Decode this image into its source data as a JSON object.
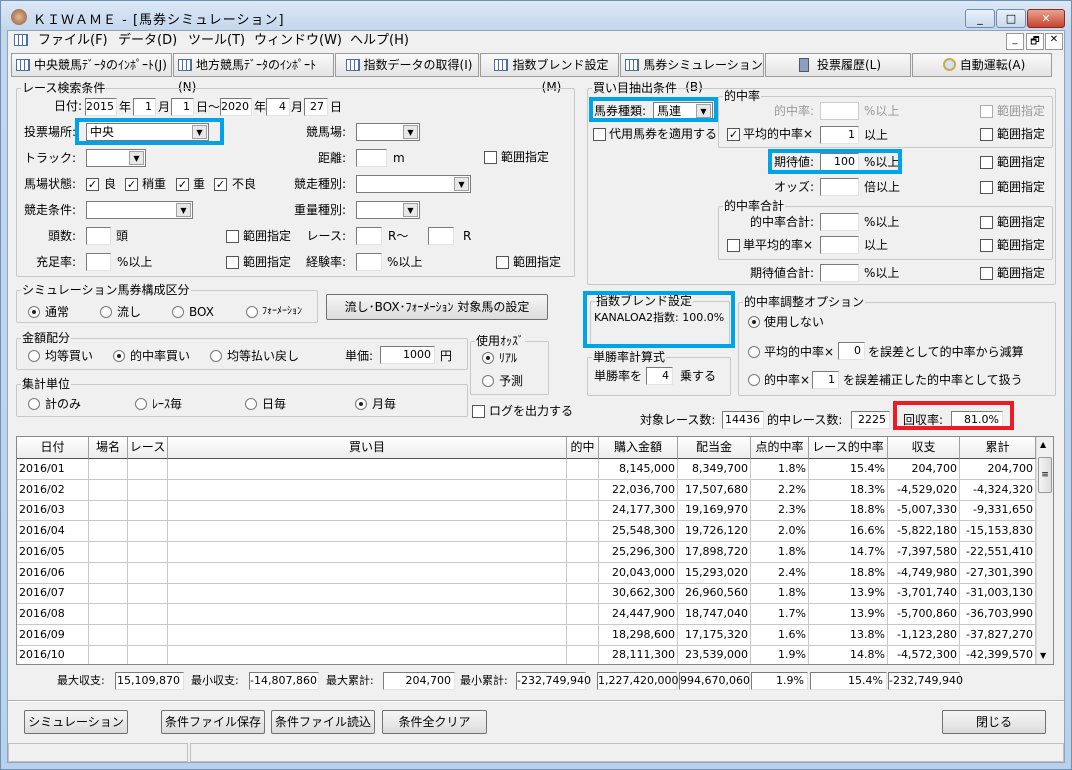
{
  "window": {
    "title": "ＫＩＷＡＭＥ - [馬券シミュレーション]",
    "minimize": "_",
    "maximize": "□",
    "close": "✕",
    "mdi_minimize": "_",
    "mdi_restore": "🗗",
    "mdi_close": "✕"
  },
  "menu": [
    "ファイル(F)",
    "データ(D)",
    "ツール(T)",
    "ウィンドウ(W)",
    "ヘルプ(H)"
  ],
  "toolbar": [
    {
      "label": "中央競馬ﾃﾞｰﾀのｲﾝﾎﾟｰﾄ(J)",
      "icon": "grid-icon"
    },
    {
      "label": "地方競馬ﾃﾞｰﾀのｲﾝﾎﾟｰﾄ(N)",
      "icon": "grid-icon"
    },
    {
      "label": "指数データの取得(I)",
      "icon": "grid-icon"
    },
    {
      "label": "指数ブレンド設定(M)",
      "icon": "grid-icon"
    },
    {
      "label": "馬券シミュレーション(B)",
      "icon": "grid-icon"
    },
    {
      "label": "投票履歴(L)",
      "icon": "calculator-icon"
    },
    {
      "label": "自動運転(A)",
      "icon": "clock-icon"
    }
  ],
  "race_search": {
    "title": "レース検索条件",
    "date_label": "日付:",
    "from_year": "2015",
    "year": "年",
    "from_month": "1",
    "month": "月",
    "from_day": "1",
    "day_tilde": "日～",
    "to_year": "2020",
    "to_month": "4",
    "to_day": "27",
    "day": "日",
    "venue_type_label": "投票場所:",
    "venue_type": "中央",
    "course_label": "競馬場:",
    "course": "",
    "track_label": "トラック:",
    "track": "",
    "distance_label": "距離:",
    "distance": "",
    "distance_unit": "m",
    "range": "範囲指定",
    "going_label": "馬場状態:",
    "going": [
      {
        "label": "良",
        "checked": true
      },
      {
        "label": "稍重",
        "checked": true
      },
      {
        "label": "重",
        "checked": true
      },
      {
        "label": "不良",
        "checked": true
      }
    ],
    "race_type_label": "競走種別:",
    "race_type": "",
    "race_cond_label": "競走条件:",
    "race_cond": "",
    "weight_type_label": "重量種別:",
    "weight_type": "",
    "heads_label": "頭数:",
    "heads": "",
    "heads_unit": "頭",
    "race_label": "レース:",
    "race_from": "",
    "race_mid": "R～",
    "race_to": "",
    "race_unit": "R",
    "fill_label": "充足率:",
    "fill": "",
    "pct_over": "%以上",
    "exp_label": "経験率:",
    "exp": ""
  },
  "composition": {
    "title": "シミュレーション馬券構成区分",
    "options": [
      "通常",
      "流し",
      "BOX",
      "ﾌｫｰﾒｰｼｮﾝ"
    ],
    "selected": "通常",
    "target_button": "流し･BOX･ﾌｫｰﾒｰｼｮﾝ  対象馬の設定"
  },
  "allocation": {
    "title": "金額配分",
    "options": [
      "均等買い",
      "的中率買い",
      "均等払い戻し"
    ],
    "selected": "的中率買い",
    "unit_label": "単価:",
    "unit_price": "1000",
    "yen": "円"
  },
  "odds": {
    "title": "使用ｵｯｽﾞ",
    "options": [
      "ﾘｱﾙ",
      "予測"
    ],
    "selected": "ﾘｱﾙ"
  },
  "aggregation": {
    "title": "集計単位",
    "options": [
      "計のみ",
      "ﾚｰｽ毎",
      "日毎",
      "月毎"
    ],
    "selected": "月毎"
  },
  "log_output": {
    "label": "ログを出力する",
    "checked": false
  },
  "bet_extract": {
    "title": "買い目抽出条件",
    "bet_type_label": "馬券種類:",
    "bet_type": "馬連",
    "substitute": {
      "label": "代用馬券を適用する",
      "checked": false
    },
    "hit_group": "的中率",
    "hit_label": "的中率:",
    "hit": "",
    "pct_over": "%以上",
    "avg_hit": {
      "label": "平均的中率×",
      "checked": true
    },
    "avg_hit_value": "1",
    "over": "以上",
    "ev_label": "期待値:",
    "ev": "100",
    "odds_label": "オッズ:",
    "odds": "",
    "odds_unit": "倍以上",
    "hit_sum_group": "的中率合計",
    "hit_sum_label": "的中率合計:",
    "hit_sum": "",
    "single_avg": {
      "label": "単平均的率×",
      "checked": false
    },
    "single_avg_value": "",
    "ev_sum_label": "期待値合計:",
    "ev_sum": "",
    "range": "範囲指定"
  },
  "blend": {
    "title": "指数ブレンド設定",
    "text": "KANALOA2指数: 100.0%"
  },
  "win_rate": {
    "title": "単勝率計算式",
    "prefix": "単勝率を",
    "value": "4",
    "suffix": "乗する"
  },
  "hit_adjust": {
    "title": "的中率調整オプション",
    "opt1": "使用しない",
    "opt2_prefix": "平均的中率×",
    "opt2_value": "0",
    "opt2_suffix": "を誤差として的中率から減算",
    "opt3_prefix": "的中率×",
    "opt3_value": "1",
    "opt3_suffix": "を誤差補正した的中率として扱う",
    "selected": 1
  },
  "counts": {
    "target_label": "対象レース数:",
    "target": "14436",
    "hit_label": "的中レース数:",
    "hit": "2225",
    "recovery_label": "回収率:",
    "recovery": "81.0%"
  },
  "table": {
    "columns": [
      "日付",
      "場名",
      "レース",
      "買い目",
      "的中",
      "購入金額",
      "配当金",
      "点的中率",
      "レース的中率",
      "収支",
      "累計"
    ],
    "rows": [
      [
        "2016/01",
        "",
        "",
        "",
        "",
        "8,145,000",
        "8,349,700",
        "1.8%",
        "15.4%",
        "204,700",
        "204,700"
      ],
      [
        "2016/02",
        "",
        "",
        "",
        "",
        "22,036,700",
        "17,507,680",
        "2.2%",
        "18.3%",
        "-4,529,020",
        "-4,324,320"
      ],
      [
        "2016/03",
        "",
        "",
        "",
        "",
        "24,177,300",
        "19,169,970",
        "2.3%",
        "18.8%",
        "-5,007,330",
        "-9,331,650"
      ],
      [
        "2016/04",
        "",
        "",
        "",
        "",
        "25,548,300",
        "19,726,120",
        "2.0%",
        "16.6%",
        "-5,822,180",
        "-15,153,830"
      ],
      [
        "2016/05",
        "",
        "",
        "",
        "",
        "25,296,300",
        "17,898,720",
        "1.8%",
        "14.7%",
        "-7,397,580",
        "-22,551,410"
      ],
      [
        "2016/06",
        "",
        "",
        "",
        "",
        "20,043,000",
        "15,293,020",
        "2.4%",
        "18.8%",
        "-4,749,980",
        "-27,301,390"
      ],
      [
        "2016/07",
        "",
        "",
        "",
        "",
        "30,662,300",
        "26,960,560",
        "1.8%",
        "13.9%",
        "-3,701,740",
        "-31,003,130"
      ],
      [
        "2016/08",
        "",
        "",
        "",
        "",
        "24,447,900",
        "18,747,040",
        "1.7%",
        "13.9%",
        "-5,700,860",
        "-36,703,990"
      ],
      [
        "2016/09",
        "",
        "",
        "",
        "",
        "18,298,600",
        "17,175,320",
        "1.6%",
        "13.8%",
        "-1,123,280",
        "-37,827,270"
      ],
      [
        "2016/10",
        "",
        "",
        "",
        "",
        "28,111,300",
        "23,539,000",
        "1.9%",
        "14.8%",
        "-4,572,300",
        "-42,399,570"
      ]
    ]
  },
  "summary": {
    "max_pl_label": "最大収支:",
    "max_pl": "15,109,870",
    "min_pl_label": "最小収支:",
    "min_pl": "-14,807,860",
    "max_cum_label": "最大累計:",
    "max_cum": "204,700",
    "min_cum_label": "最小累計:",
    "min_cum": "-232,749,940",
    "total_buy": "1,227,420,000",
    "total_payout": "994,670,060",
    "point_hit": "1.9%",
    "race_hit": "15.4%",
    "total_pl": "-232,749,940"
  },
  "buttons": {
    "simulate": "シミュレーション",
    "save": "条件ファイル保存",
    "load": "条件ファイル読込",
    "clear": "条件全クリア",
    "close": "閉じる"
  },
  "colors": {
    "highlight_blue": "#00a2e8",
    "highlight_red": "#ed1c24"
  }
}
